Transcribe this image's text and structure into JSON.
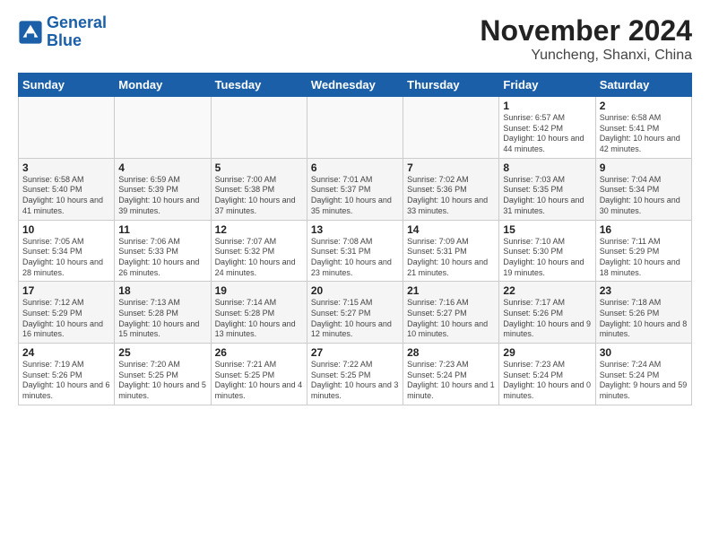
{
  "header": {
    "logo_line1": "General",
    "logo_line2": "Blue",
    "title": "November 2024",
    "subtitle": "Yuncheng, Shanxi, China"
  },
  "days_of_week": [
    "Sunday",
    "Monday",
    "Tuesday",
    "Wednesday",
    "Thursday",
    "Friday",
    "Saturday"
  ],
  "weeks": [
    [
      {
        "day": "",
        "info": ""
      },
      {
        "day": "",
        "info": ""
      },
      {
        "day": "",
        "info": ""
      },
      {
        "day": "",
        "info": ""
      },
      {
        "day": "",
        "info": ""
      },
      {
        "day": "1",
        "info": "Sunrise: 6:57 AM\nSunset: 5:42 PM\nDaylight: 10 hours\nand 44 minutes."
      },
      {
        "day": "2",
        "info": "Sunrise: 6:58 AM\nSunset: 5:41 PM\nDaylight: 10 hours\nand 42 minutes."
      }
    ],
    [
      {
        "day": "3",
        "info": "Sunrise: 6:58 AM\nSunset: 5:40 PM\nDaylight: 10 hours\nand 41 minutes."
      },
      {
        "day": "4",
        "info": "Sunrise: 6:59 AM\nSunset: 5:39 PM\nDaylight: 10 hours\nand 39 minutes."
      },
      {
        "day": "5",
        "info": "Sunrise: 7:00 AM\nSunset: 5:38 PM\nDaylight: 10 hours\nand 37 minutes."
      },
      {
        "day": "6",
        "info": "Sunrise: 7:01 AM\nSunset: 5:37 PM\nDaylight: 10 hours\nand 35 minutes."
      },
      {
        "day": "7",
        "info": "Sunrise: 7:02 AM\nSunset: 5:36 PM\nDaylight: 10 hours\nand 33 minutes."
      },
      {
        "day": "8",
        "info": "Sunrise: 7:03 AM\nSunset: 5:35 PM\nDaylight: 10 hours\nand 31 minutes."
      },
      {
        "day": "9",
        "info": "Sunrise: 7:04 AM\nSunset: 5:34 PM\nDaylight: 10 hours\nand 30 minutes."
      }
    ],
    [
      {
        "day": "10",
        "info": "Sunrise: 7:05 AM\nSunset: 5:34 PM\nDaylight: 10 hours\nand 28 minutes."
      },
      {
        "day": "11",
        "info": "Sunrise: 7:06 AM\nSunset: 5:33 PM\nDaylight: 10 hours\nand 26 minutes."
      },
      {
        "day": "12",
        "info": "Sunrise: 7:07 AM\nSunset: 5:32 PM\nDaylight: 10 hours\nand 24 minutes."
      },
      {
        "day": "13",
        "info": "Sunrise: 7:08 AM\nSunset: 5:31 PM\nDaylight: 10 hours\nand 23 minutes."
      },
      {
        "day": "14",
        "info": "Sunrise: 7:09 AM\nSunset: 5:31 PM\nDaylight: 10 hours\nand 21 minutes."
      },
      {
        "day": "15",
        "info": "Sunrise: 7:10 AM\nSunset: 5:30 PM\nDaylight: 10 hours\nand 19 minutes."
      },
      {
        "day": "16",
        "info": "Sunrise: 7:11 AM\nSunset: 5:29 PM\nDaylight: 10 hours\nand 18 minutes."
      }
    ],
    [
      {
        "day": "17",
        "info": "Sunrise: 7:12 AM\nSunset: 5:29 PM\nDaylight: 10 hours\nand 16 minutes."
      },
      {
        "day": "18",
        "info": "Sunrise: 7:13 AM\nSunset: 5:28 PM\nDaylight: 10 hours\nand 15 minutes."
      },
      {
        "day": "19",
        "info": "Sunrise: 7:14 AM\nSunset: 5:28 PM\nDaylight: 10 hours\nand 13 minutes."
      },
      {
        "day": "20",
        "info": "Sunrise: 7:15 AM\nSunset: 5:27 PM\nDaylight: 10 hours\nand 12 minutes."
      },
      {
        "day": "21",
        "info": "Sunrise: 7:16 AM\nSunset: 5:27 PM\nDaylight: 10 hours\nand 10 minutes."
      },
      {
        "day": "22",
        "info": "Sunrise: 7:17 AM\nSunset: 5:26 PM\nDaylight: 10 hours\nand 9 minutes."
      },
      {
        "day": "23",
        "info": "Sunrise: 7:18 AM\nSunset: 5:26 PM\nDaylight: 10 hours\nand 8 minutes."
      }
    ],
    [
      {
        "day": "24",
        "info": "Sunrise: 7:19 AM\nSunset: 5:26 PM\nDaylight: 10 hours\nand 6 minutes."
      },
      {
        "day": "25",
        "info": "Sunrise: 7:20 AM\nSunset: 5:25 PM\nDaylight: 10 hours\nand 5 minutes."
      },
      {
        "day": "26",
        "info": "Sunrise: 7:21 AM\nSunset: 5:25 PM\nDaylight: 10 hours\nand 4 minutes."
      },
      {
        "day": "27",
        "info": "Sunrise: 7:22 AM\nSunset: 5:25 PM\nDaylight: 10 hours\nand 3 minutes."
      },
      {
        "day": "28",
        "info": "Sunrise: 7:23 AM\nSunset: 5:24 PM\nDaylight: 10 hours\nand 1 minute."
      },
      {
        "day": "29",
        "info": "Sunrise: 7:23 AM\nSunset: 5:24 PM\nDaylight: 10 hours\nand 0 minutes."
      },
      {
        "day": "30",
        "info": "Sunrise: 7:24 AM\nSunset: 5:24 PM\nDaylight: 9 hours\nand 59 minutes."
      }
    ]
  ]
}
